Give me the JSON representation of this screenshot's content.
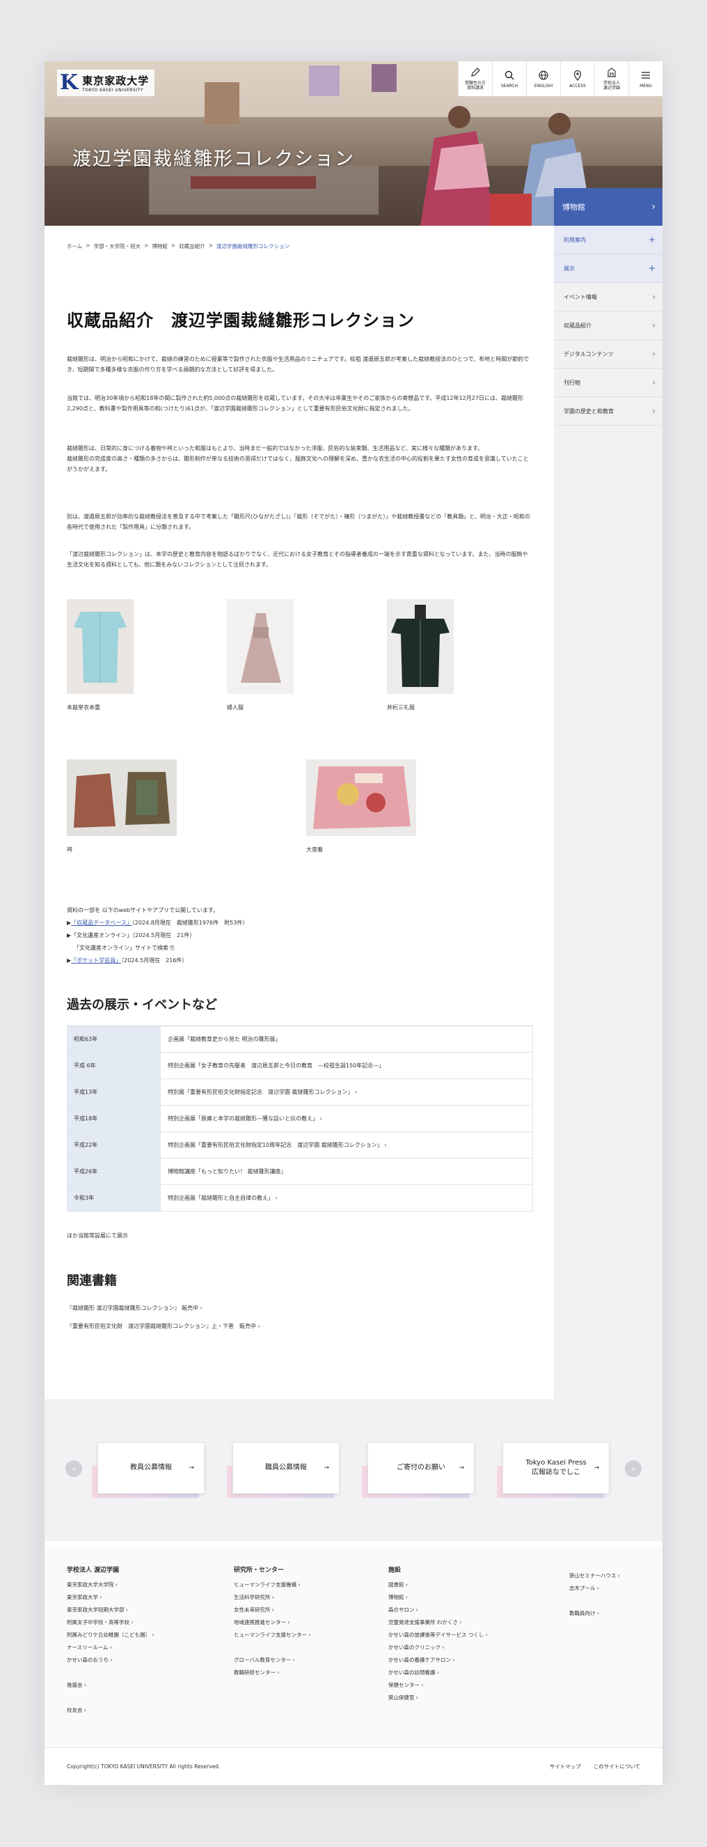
{
  "header": {
    "logo_jp": "東京家政大学",
    "logo_en": "TOKYO KASEI UNIVERSITY",
    "toolbar": [
      {
        "label": "受験生の方\n資料請求",
        "icon": "pencil-icon"
      },
      {
        "label": "SEARCH",
        "icon": "search-icon"
      },
      {
        "label": "ENGLISH",
        "icon": "globe-icon"
      },
      {
        "label": "ACCESS",
        "icon": "map-pin-icon"
      },
      {
        "label": "学校法人\n渡辺学園",
        "icon": "building-icon"
      },
      {
        "label": "MENU",
        "icon": "menu-icon"
      }
    ],
    "hero_title": "渡辺学園裁縫雛形コレクション"
  },
  "sidebar": {
    "head": "博物館",
    "items": [
      {
        "label": "利用案内",
        "mark": "+"
      },
      {
        "label": "展示",
        "mark": "+"
      },
      {
        "label": "イベント情報",
        "mark": "›"
      },
      {
        "label": "収蔵品紹介",
        "mark": "›"
      },
      {
        "label": "デジタルコンテンツ",
        "mark": "›"
      },
      {
        "label": "刊行物",
        "mark": "›"
      },
      {
        "label": "学園の歴史と和教育",
        "mark": "›"
      }
    ]
  },
  "breadcrumb": [
    "ホーム",
    "学部・大学院・短大",
    "博物館",
    "収蔵品紹介",
    "渡辺学園裁縫雛形コレクション"
  ],
  "page_title": "収蔵品紹介　渡辺学園裁縫雛形コレクション",
  "paragraphs": [
    "裁縫雛形は、明治から昭和にかけて、裁縫の練習のために授業等で製作された衣服や生活用品のミニチュアです。校祖 渡邉辰五郎が考案した裁縫教授法のひとつで、布地と時間が節約でき、短期間で多種多様な衣服の作り方を学べる画期的な方法として好評を得ました。",
    "当館では、明治30年頃から昭和18年の間に製作された約5,000点の裁縫雛形を収蔵しています。その大半は卒業生やそのご家族からの寄贈品です。平成12年12月27日には、裁縫雛形2,290点と、教科書や製作用具等の和(つけたり)61点が、「渡辺学園裁縫雛形コレクション」として重要有形民俗文化財に指定されました。",
    "裁縫雛形は、日常的に身につける着物や袴といった和服はもとより、当時まだ一般的ではなかった洋服、民俗的な装束類、生活用品など、実に様々な種類があります。\n裁縫雛形の完成度の高さ・種類の多さからは、雛形制作が単なる技術の習得だけではなく、服飾文化への理解を深め、豊かな衣生活の中心的役割を果たす女性の育成を意識していたことがうかがえます。",
    "別は、渡邉辰五郎が効率的な裁縫教授法を普及する中で考案した「雛形尺(ひながたざし)」「裁形（そでがた）・褄形（つまがた）」や裁縫教授書などの「教具類」と、明治・大正・昭和の各時代で使用された「製作用具」に分類されます。",
    "「渡辺裁縫雛形コレクション」は、本学の歴史と教育内容を物語るばかりでなく、近代における女子教育とその指導者養成の一端を示す貴重な資料となっています。また、当時の服飾や生活文化を知る資料としても、他に類をみないコレクションとして注目されます。"
  ],
  "gallery": [
    {
      "caption": "本裁単衣本重"
    },
    {
      "caption": "婦人服"
    },
    {
      "caption": "井桁三礼服"
    },
    {
      "caption": "袴"
    },
    {
      "caption": "大夜着"
    }
  ],
  "publication": {
    "intro": "資料の一部を 以下のwebサイトやアプリで公開しています。",
    "items": [
      {
        "bullet": "▶",
        "link": "「収蔵品データベース」",
        "rest": "（2024.8月現在　裁縫雛形1976件　附53件）"
      },
      {
        "bullet": "▶",
        "link": "",
        "rest": "「文化遺産オンライン」（2024.5月現在　21件）"
      },
      {
        "bullet": "",
        "link": "",
        "rest": "「文化遺産オンライン」サイトで検索 ⎘"
      },
      {
        "bullet": "▶",
        "link": "「ポケット学芸員」",
        "rest": "（2024.5月現在　216件）"
      }
    ]
  },
  "events": {
    "heading": "過去の展示・イベントなど",
    "rows": [
      {
        "year": "昭和63年",
        "event": "企画展「裁縫教育史から見た 明治の雛形展」"
      },
      {
        "year": "平成 6年",
        "event": "特別企画展「女子教育の先駆者　渡辺辰五郎と今日の教育　—校祖生誕150年記念—」"
      },
      {
        "year": "平成13年",
        "event": "特別展「重要有形民俗文化財指定記念　渡辺学園 裁縫雛形コレクション」 ›"
      },
      {
        "year": "平成18年",
        "event": "特別企画展「辰庫と本学の裁縫雛形—獲な話いと伝の教え」 ›"
      },
      {
        "year": "平成22年",
        "event": "特別企画展「重要有形民俗文化財指定10周年記念　渡辺学園 裁縫雛形コレクション」 ›"
      },
      {
        "year": "平成26年",
        "event": "博物館講座「もっと知りたい！ 裁縫雛形講座」"
      },
      {
        "year": "令和3年",
        "event": "特別企画展「裁縫雛形と自主自律の教え」 ›"
      }
    ],
    "note": "ほか当館常設展にて展示"
  },
  "books": {
    "heading": "関連書籍",
    "items": [
      "『裁縫雛形 渡辺学園裁縫雛形コレクション』 販売中 ›",
      "『重要有形民俗文化財　渡辺学園裁縫雛形コレクション』上・下巻　販売中 ›"
    ]
  },
  "banners": [
    {
      "label": "教員公募情報"
    },
    {
      "label": "職員公募情報"
    },
    {
      "label": "ご寄付のお願い"
    },
    {
      "label": "Tokyo Kasei Press\n広報誌なでしこ"
    }
  ],
  "footer": {
    "columns": [
      {
        "heading": "学校法人 渡辺学園",
        "items": [
          "東京家政大学大学院 ›",
          "東京家政大学 ›",
          "東京家政大学短期大学部 ›",
          "附属女子中学校・高等学校 ›",
          "附属みどりケ丘幼稚園（こども園） ›",
          "ナースリールーム ›",
          "かせい森のおうち ›",
          "",
          "後援会 ›",
          "",
          "校友会 ›"
        ]
      },
      {
        "heading": "研究所・センター",
        "items": [
          "ヒューマンライフ支援機構 ›",
          "生活科学研究所 ›",
          "女性未来研究所 ›",
          "地域連携推進センター ›",
          "ヒューマンライフ支援センター ›",
          "",
          "グローバル教育センター ›",
          "教職研修センター ›"
        ]
      },
      {
        "heading": "施設",
        "items": [
          "図書館 ›",
          "博物館 ›",
          "森のサロン ›",
          "児童発達支援事業所 わかくさ ›",
          "かせい森の放課後等デイサービス つくし ›",
          "かせい森のクリニック ›",
          "かせい森の看護ケアサロン ›",
          "かせい森の訪問看護 ›",
          "保健センター ›",
          "狭山保健室 ›"
        ]
      },
      {
        "heading": "",
        "items": [
          "狭山セミナーハウス ›",
          "志木プール ›",
          "",
          "教職員向け ›"
        ]
      }
    ],
    "copyright": "Copyright(c) TOKYO KASEI UNIVERSITY All rights Reserved.",
    "links": [
      "サイトマップ",
      "このサイトについて"
    ]
  }
}
